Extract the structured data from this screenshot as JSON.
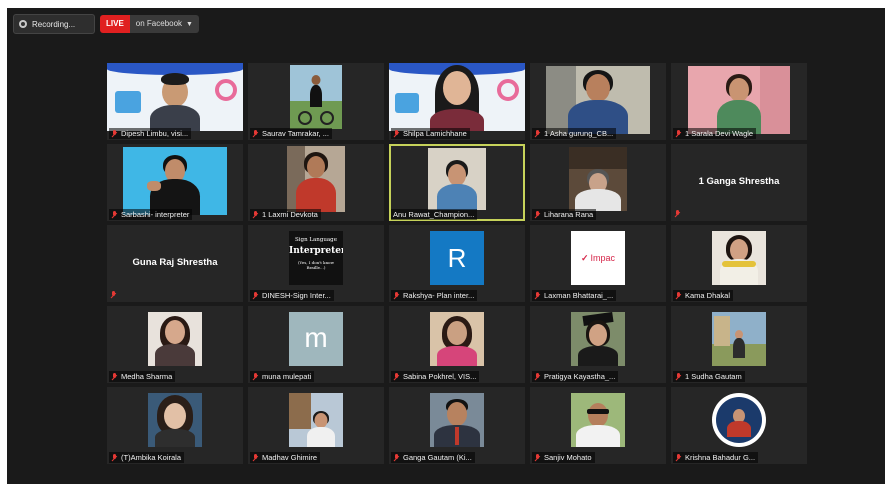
{
  "topbar": {
    "recording_label": "Recording...",
    "live_badge": "LIVE",
    "live_destination": "on Facebook",
    "caret_icon": "chevron-down-icon"
  },
  "tiles": [
    {
      "name": "Dipesh Limbu, visi...",
      "type": "video"
    },
    {
      "name": "Saurav Tamrakar, ...",
      "type": "video"
    },
    {
      "name": "Shilpa Lamichhane",
      "type": "video"
    },
    {
      "name": "1 Asha gurung_CB...",
      "type": "video"
    },
    {
      "name": "1 Sarala Devi Wagle",
      "type": "video"
    },
    {
      "name": "Sarbashi- interpreter",
      "type": "video"
    },
    {
      "name": "1 Laxmi Devkota",
      "type": "video"
    },
    {
      "name": "Anu Rawat_Champion...",
      "type": "video",
      "active": true
    },
    {
      "name": "Liharana Rana",
      "type": "video"
    },
    {
      "name": "1 Ganga Shrestha",
      "type": "name-only"
    },
    {
      "name": "Guna Raj Shrestha",
      "type": "name-only"
    },
    {
      "name": "DINESH-Sign Inter...",
      "type": "avatar",
      "card_title": "Sign Language",
      "card_main": "Interpreter",
      "card_sub": "(Yes, I don't know Braille...)"
    },
    {
      "name": "Rakshya- Plan inter...",
      "type": "avatar",
      "card_letter": "R"
    },
    {
      "name": "Laxman Bhattarai_...",
      "type": "avatar",
      "card_text": "Impac"
    },
    {
      "name": "Kama Dhakal",
      "type": "photo"
    },
    {
      "name": "Medha Sharma",
      "type": "photo"
    },
    {
      "name": "muna mulepati",
      "type": "avatar",
      "card_letter": "m"
    },
    {
      "name": "Sabina Pokhrel, VIS...",
      "type": "photo"
    },
    {
      "name": "Pratigya Kayastha_...",
      "type": "photo"
    },
    {
      "name": "1 Sudha Gautam",
      "type": "photo"
    },
    {
      "name": "(T)Ambika Koirala",
      "type": "photo"
    },
    {
      "name": "Madhav Ghimire",
      "type": "photo"
    },
    {
      "name": "Ganga Gautam (Ki...",
      "type": "photo"
    },
    {
      "name": "Sanjiv Mohato",
      "type": "photo"
    },
    {
      "name": "Krishna Bahadur G...",
      "type": "photo"
    }
  ],
  "colors": {
    "window_bg": "#1a1a1a",
    "tile_bg": "#262626",
    "live_red": "#e02020",
    "active_speaker_border": "#c6d25a",
    "muted_mic": "#e53935"
  }
}
